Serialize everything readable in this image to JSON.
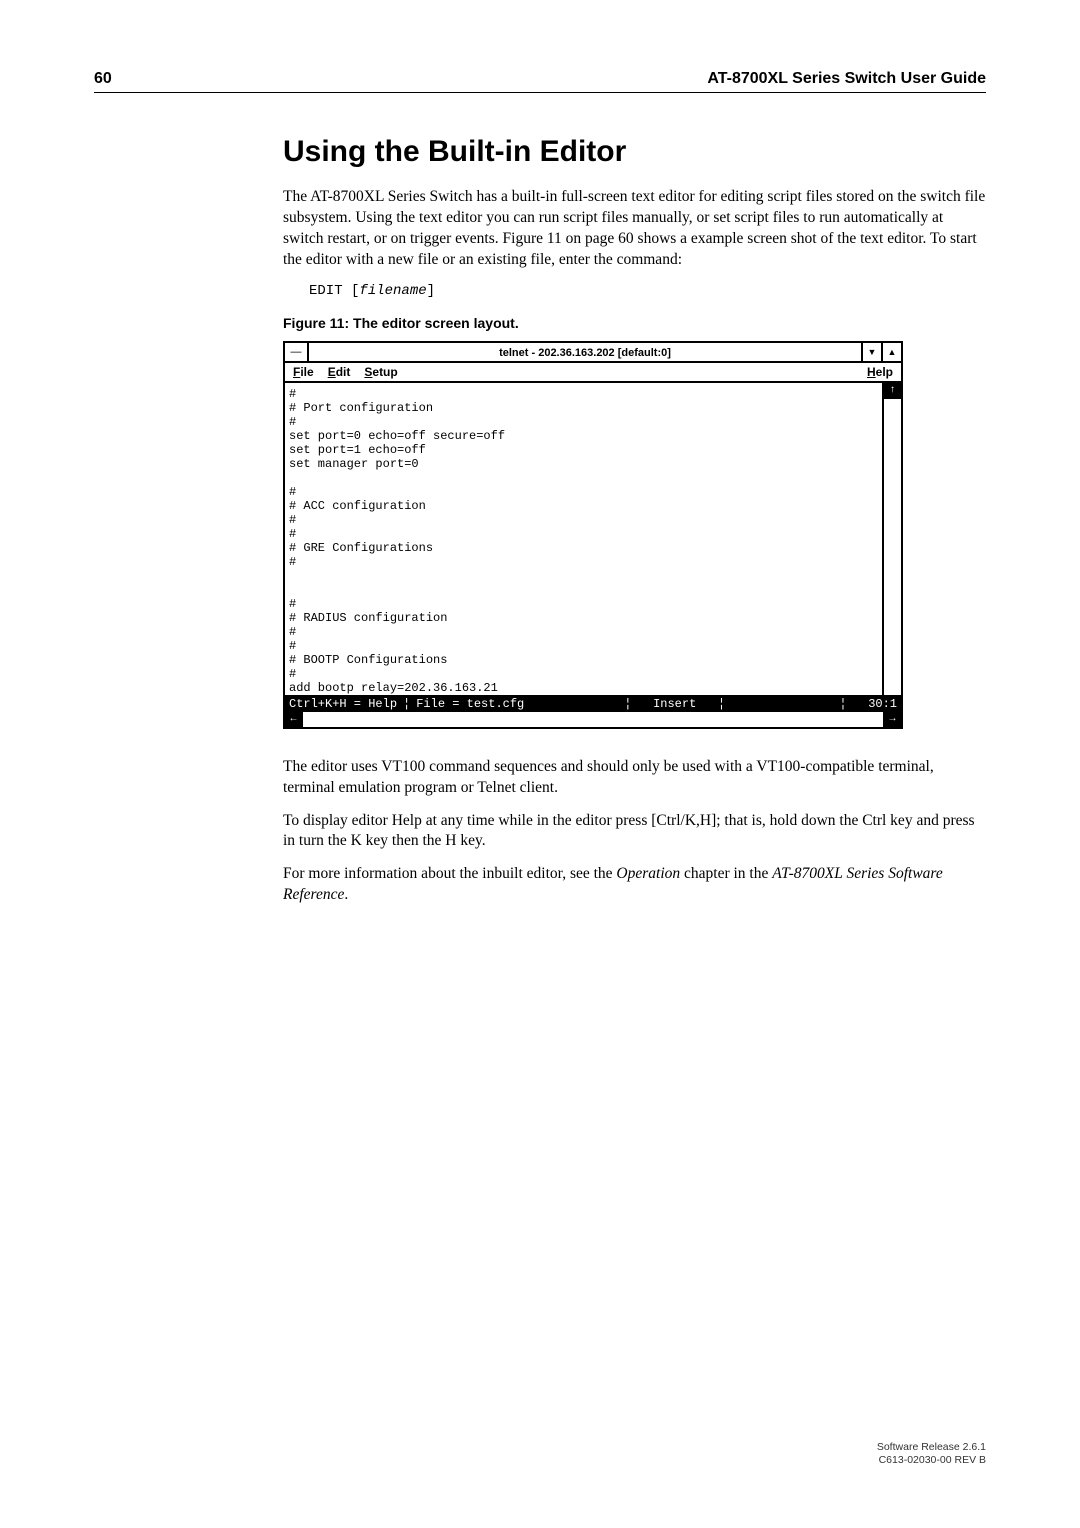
{
  "page": {
    "page_number": "60",
    "guide_title": "AT-8700XL Series Switch User Guide"
  },
  "section": {
    "title": "Using the Built-in Editor",
    "para1": "The AT-8700XL Series Switch has a built-in full-screen text editor for editing script files stored on the switch file subsystem. Using the text editor you can run script files manually, or set script files to run automatically at switch restart, or on trigger events. Figure 11 on page 60 shows a example screen shot of the text editor. To start the editor with a new file or an existing file, enter the command:",
    "command_prefix": "EDIT [",
    "command_filename": "filename",
    "command_suffix": "]",
    "figure_caption": "Figure 11: The editor screen layout.",
    "para2": "The editor uses VT100 command sequences and should only be used with a VT100-compatible terminal, terminal emulation program or Telnet client.",
    "para3": "To display editor Help at any time while in the editor press [Ctrl/K,H]; that is, hold down the Ctrl key and press in turn the K key then the H key.",
    "para4_pre": "For more information about the inbuilt editor, see the ",
    "para4_ital1": "Operation",
    "para4_mid": " chapter in the ",
    "para4_ital2": "AT-8700XL Series Software Reference",
    "para4_end": "."
  },
  "editor": {
    "title": "telnet - 202.36.163.202 [default:0]",
    "menu": {
      "file": "File",
      "edit": "Edit",
      "setup": "Setup",
      "help": "Help"
    },
    "content_lines": "#\n# Port configuration\n#\nset port=0 echo=off secure=off\nset port=1 echo=off\nset manager port=0\n\n#\n# ACC configuration\n#\n#\n# GRE Configurations\n#\n\n\n#\n# RADIUS configuration\n#\n#\n# BOOTP Configurations\n#\nadd bootp relay=202.36.163.21\n",
    "status": {
      "help": "Ctrl+K+H = Help",
      "file": "File = test.cfg",
      "mode": "Insert",
      "pos": "30:1"
    }
  },
  "footer": {
    "line1": "Software Release 2.6.1",
    "line2": "C613-02030-00 REV B"
  }
}
